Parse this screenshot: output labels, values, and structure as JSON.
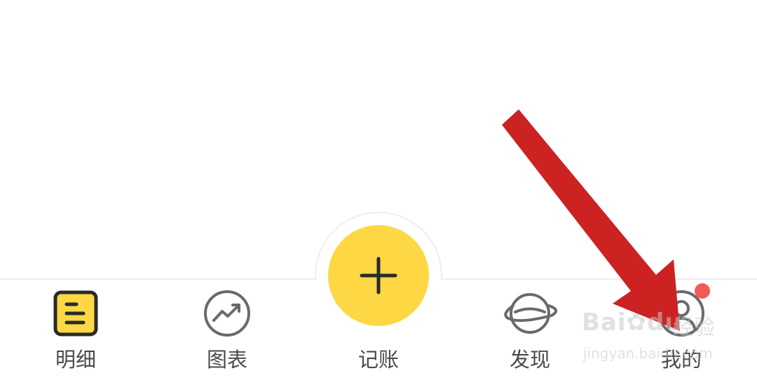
{
  "tabbar": {
    "items": [
      {
        "label": "明细",
        "icon": "list-icon"
      },
      {
        "label": "图表",
        "icon": "chart-trend-icon"
      },
      {
        "label": "记账",
        "icon": "plus-icon"
      },
      {
        "label": "发现",
        "icon": "planet-icon"
      },
      {
        "label": "我的",
        "icon": "user-icon"
      }
    ]
  },
  "colors": {
    "accent": "#fdd844",
    "badge": "#f25a57",
    "annotation_arrow": "#cc2222",
    "label": "#4a4a4a"
  },
  "watermark": {
    "brand": "Bai",
    "brand_suffix": "du",
    "cn": "经验",
    "url": "jingyan.baidu.com"
  }
}
